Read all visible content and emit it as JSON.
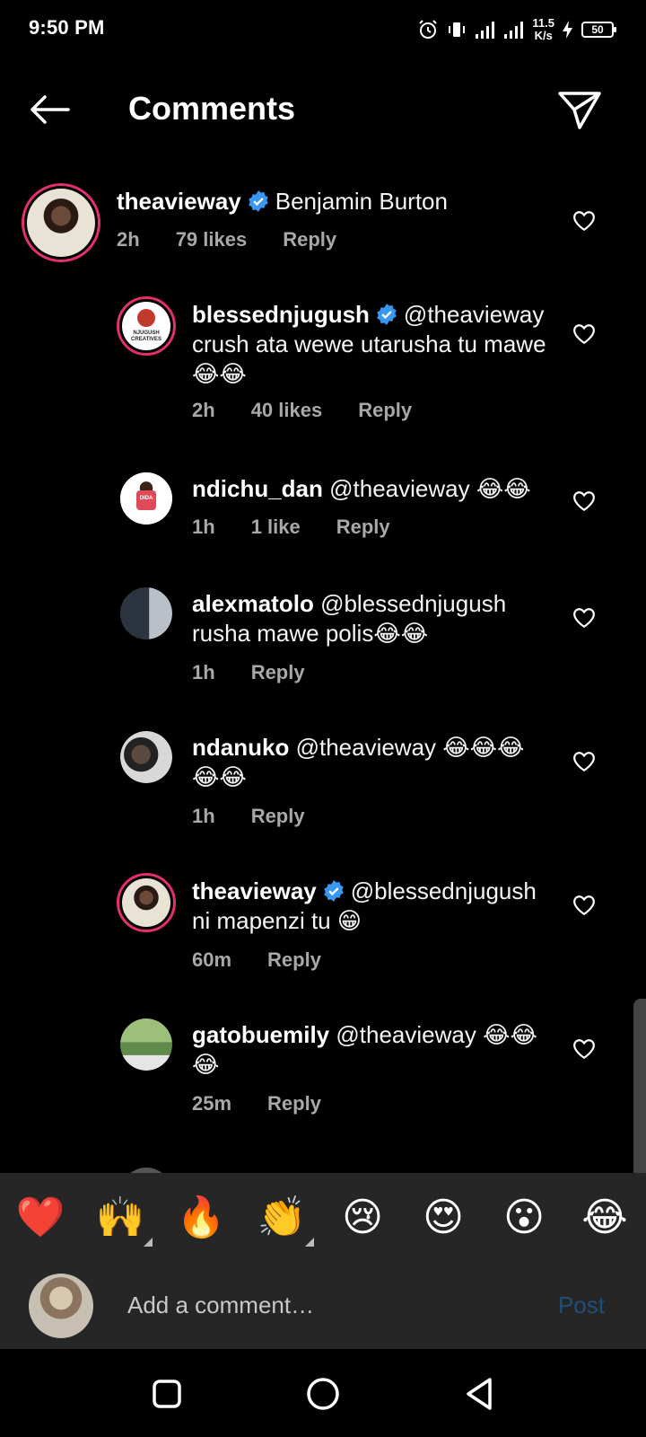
{
  "status_bar": {
    "time": "9:50 PM",
    "speed_value": "11.5",
    "speed_unit": "K/s",
    "battery": "50"
  },
  "header": {
    "title": "Comments"
  },
  "comments": [
    {
      "username": "theavieway",
      "verified": true,
      "text": "Benjamin Burton",
      "time": "2h",
      "likes": "79 likes",
      "reply": "Reply"
    },
    {
      "username": "blessednjugush",
      "verified": true,
      "text": "@theavieway crush ata wewe utarusha tu mawe😂😂",
      "time": "2h",
      "likes": "40 likes",
      "reply": "Reply"
    },
    {
      "username": "ndichu_dan",
      "verified": false,
      "text": "@theavieway 😂😂",
      "time": "1h",
      "likes": "1 like",
      "reply": "Reply"
    },
    {
      "username": "alexmatolo",
      "verified": false,
      "text": "@blessednjugush rusha mawe polis😂😂",
      "time": "1h",
      "likes": "",
      "reply": "Reply"
    },
    {
      "username": "ndanuko",
      "verified": false,
      "text": "@theavieway 😂😂😂😂😂",
      "time": "1h",
      "likes": "",
      "reply": "Reply"
    },
    {
      "username": "theavieway",
      "verified": true,
      "text": "@blessednjugush ni mapenzi tu 😁",
      "time": "60m",
      "likes": "",
      "reply": "Reply"
    },
    {
      "username": "gatobuemily",
      "verified": false,
      "text": "@theavieway 😂😂😂",
      "time": "25m",
      "likes": "",
      "reply": "Reply"
    }
  ],
  "avatar_texts": {
    "njugush_logo": "NJUGUSH CREATIVES",
    "ndichu_shirt": "DIDA"
  },
  "emoji_bar": [
    "❤️",
    "🙌",
    "🔥",
    "👏",
    "😢",
    "😍",
    "😮",
    "😂"
  ],
  "composer": {
    "placeholder": "Add a comment…",
    "post_label": "Post"
  },
  "colors": {
    "background": "#000000",
    "verified_blue": "#3897f0",
    "post_disabled": "#1d4f7a",
    "story_ring": "#e1306c",
    "meta_gray": "#a8a8a8"
  }
}
